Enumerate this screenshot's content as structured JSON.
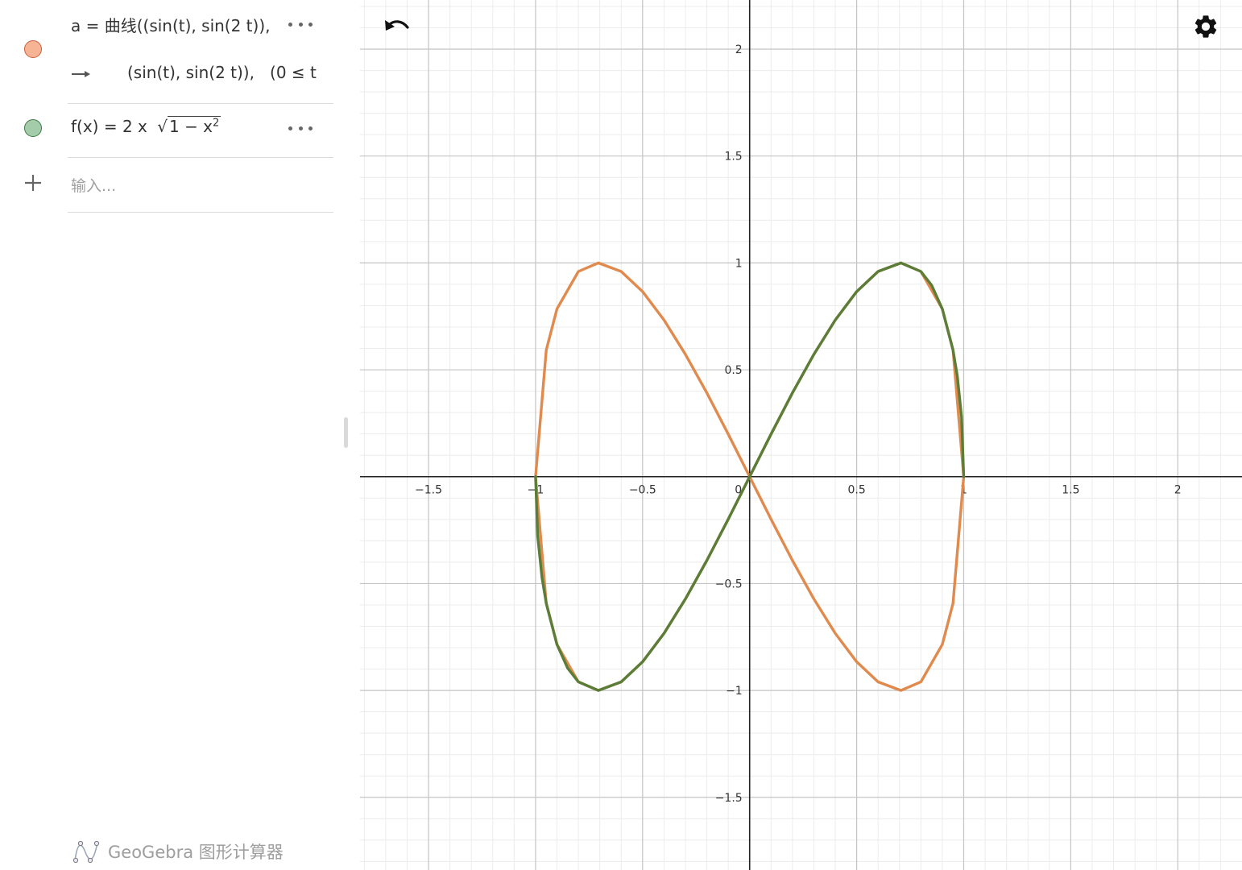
{
  "algebra": {
    "items": [
      {
        "marble_color": "#f6b495",
        "marble_border": "#c8603a",
        "definition": "a = 曲线((sin(t), sin(2 t)),",
        "output": "(sin(t), sin(2 t)),   (0 ≤ t"
      },
      {
        "marble_color": "#a5ccaa",
        "marble_border": "#3e7b46",
        "definition_prefix": "f(x) = 2 x",
        "radicand": "1 − x",
        "exponent": "2"
      }
    ],
    "input_placeholder": "输入..."
  },
  "footer": {
    "brand": "GeoGebra 图形计算器"
  },
  "colors": {
    "curve": "#e08a4e",
    "function": "#5a7d38",
    "axis": "#222222",
    "grid_major": "#c4c4c4",
    "grid_minor": "#ececec"
  },
  "icons": {
    "undo": "undo-icon",
    "settings": "gear-icon",
    "add": "plus-icon",
    "output_arrow": "arrow-right-icon",
    "more": "more-icon"
  },
  "chart_data": {
    "type": "line",
    "x_range": [
      -1.82,
      2.3
    ],
    "y_range": [
      -1.84,
      2.23
    ],
    "x_ticks": [
      -1.5,
      -1,
      -0.5,
      0,
      0.5,
      1,
      1.5,
      2
    ],
    "y_ticks": [
      -1.5,
      -1,
      -0.5,
      0.5,
      1,
      1.5,
      2
    ],
    "x_tick_labels": [
      "−1.5",
      "−1",
      "−0.5",
      "0",
      "0.5",
      "1",
      "1.5",
      "2"
    ],
    "y_tick_labels": [
      "−1.5",
      "−1",
      "−0.5",
      "0.5",
      "1",
      "1.5",
      "2"
    ],
    "major_step": 0.5,
    "minor_step": 0.1,
    "grid": true,
    "series": [
      {
        "curve": "parametric",
        "color": "#e08a4e",
        "x": [
          0,
          0.1,
          0.2,
          0.3,
          0.4,
          0.5,
          0.6,
          0.707,
          0.8,
          0.9,
          0.95,
          1,
          0.95,
          0.9,
          0.8,
          0.707,
          0.6,
          0.5,
          0.4,
          0.3,
          0.2,
          0.1,
          0,
          -0.1,
          -0.2,
          -0.3,
          -0.4,
          -0.5,
          -0.6,
          -0.707,
          -0.8,
          -0.9,
          -0.95,
          -1,
          -0.95,
          -0.9,
          -0.8,
          -0.707,
          -0.6,
          -0.5,
          -0.4,
          -0.3,
          -0.2,
          -0.1,
          0
        ],
        "y": [
          0,
          0.199,
          0.392,
          0.572,
          0.733,
          0.866,
          0.96,
          1,
          0.96,
          0.785,
          0.593,
          0,
          -0.593,
          -0.785,
          -0.96,
          -1,
          -0.96,
          -0.866,
          -0.733,
          -0.572,
          -0.392,
          -0.199,
          0,
          0.199,
          0.392,
          0.572,
          0.733,
          0.866,
          0.96,
          1,
          0.96,
          0.785,
          0.593,
          0,
          -0.593,
          -0.785,
          -0.96,
          -1,
          -0.96,
          -0.866,
          -0.733,
          -0.572,
          -0.392,
          -0.199,
          0
        ]
      },
      {
        "curve": "function",
        "color": "#5a7d38",
        "x": [
          -1,
          -0.99,
          -0.97,
          -0.95,
          -0.9,
          -0.85,
          -0.8,
          -0.707,
          -0.6,
          -0.5,
          -0.4,
          -0.3,
          -0.2,
          -0.1,
          0,
          0.1,
          0.2,
          0.3,
          0.4,
          0.5,
          0.6,
          0.707,
          0.8,
          0.85,
          0.9,
          0.95,
          0.97,
          0.99,
          1
        ],
        "y": [
          0,
          -0.279,
          -0.472,
          -0.593,
          -0.785,
          -0.896,
          -0.96,
          -1,
          -0.96,
          -0.866,
          -0.733,
          -0.572,
          -0.392,
          -0.199,
          0,
          0.199,
          0.392,
          0.572,
          0.733,
          0.866,
          0.96,
          1,
          0.96,
          0.896,
          0.785,
          0.593,
          0.472,
          0.279,
          0
        ]
      }
    ]
  }
}
